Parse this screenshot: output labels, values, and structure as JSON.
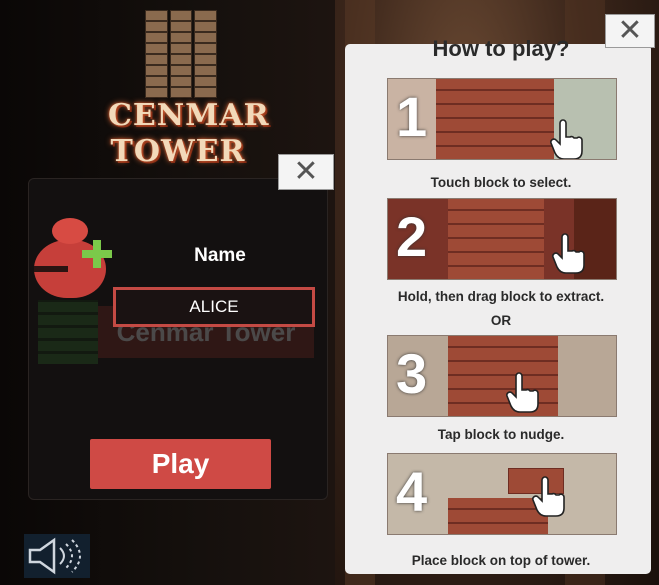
{
  "app": {
    "logo_text_line1": "CENMAR",
    "logo_text_line2": "TOWER"
  },
  "profile": {
    "name_label": "Name",
    "name_value": "ALICE",
    "ghost_text": "Cenmar Tower",
    "play_label": "Play"
  },
  "howto": {
    "title": "How to play?",
    "or_label": "OR",
    "steps": [
      {
        "number": "1",
        "caption": "Touch block to select."
      },
      {
        "number": "2",
        "caption": "Hold, then drag block to extract."
      },
      {
        "number": "3",
        "caption": "Tap block to nudge."
      },
      {
        "number": "4",
        "caption": "Place block on top of tower."
      }
    ]
  },
  "icons": {
    "close": "close-icon",
    "speaker": "speaker-icon",
    "hand": "hand-pointer-icon",
    "avatar": "user-add-icon"
  },
  "colors": {
    "accent_red": "#cf4a45",
    "plus_green": "#7bc94a",
    "panel_light": "#efeeee"
  }
}
